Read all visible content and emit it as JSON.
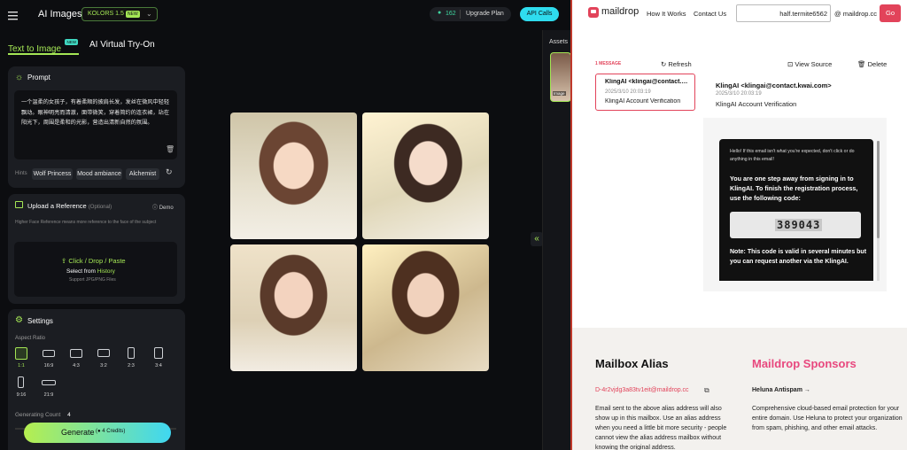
{
  "left": {
    "header": {
      "title": "AI Images",
      "model_label": "KOLORS 1.5",
      "model_badge": "NEW",
      "credits": "162",
      "upgrade_label": "Upgrade Plan",
      "api_label": "API Calls"
    },
    "tabs": [
      {
        "label": "Text to Image",
        "badge": "NEW",
        "active": true
      },
      {
        "label": "AI Virtual Try-On",
        "active": false
      }
    ],
    "prompt": {
      "title": "Prompt",
      "text": "一个温柔的女孩子，有着柔顺的披肩长发，发丝在微风中轻轻飘动。眼神明亮而清澈，面带微笑，穿着简约的连衣裙，站在阳光下，周围是柔和的光影，营造出清新自然的氛围。",
      "hints_label": "Hints",
      "hints": [
        "Wolf Princess",
        "Mood ambiance",
        "Alchemist"
      ]
    },
    "reference": {
      "title": "Upload a Reference",
      "optional": "(Optional)",
      "demo_label": "Demo",
      "description": "Higher Face Reference means more reference to the face of the subject",
      "upload_label": "Click / Drop / Paste",
      "select_from": "Select from",
      "history_link": "History",
      "support_text": "Support JPG/PNG Files"
    },
    "settings": {
      "title": "Settings",
      "aspect_label": "Aspect Ratio",
      "ratios": [
        "1:1",
        "16:9",
        "4:3",
        "3:2",
        "2:3",
        "3:4",
        "9:16",
        "21:9"
      ],
      "count_label": "Generating Count",
      "count_value": "4"
    },
    "generate": {
      "label": "Generate",
      "credits": "4 Credits"
    },
    "assets_label": "Assets",
    "assets_thumb_label": "Image",
    "colors": {
      "accent_green": "#a4e655",
      "accent_cyan": "#3fd7f2",
      "panel": "#1b1d22"
    }
  },
  "right": {
    "brand": "maildrop",
    "nav": [
      "How It Works",
      "Contact Us"
    ],
    "alias_input": "half.termite6562",
    "domain": "@ maildrop.cc",
    "go_label": "Go",
    "message_count": "1 MESSAGE",
    "refresh_label": "Refresh",
    "view_source_label": "View Source",
    "delete_label": "Delete",
    "list_item": {
      "from": "KlingAI <klingai@contact.kwai.com>",
      "date": "2025/3/10 20:03:19",
      "subject": "KlingAI Account Verification"
    },
    "email": {
      "from": "KlingAI <klingai@contact.kwai.com>",
      "date": "2025/3/10 20:03:19",
      "subject": "KlingAI Account Verification",
      "notice": "Hello! If this email isn't what you're expected, don't click or do anything in this email!",
      "body": "You are one step away from signing in to KlingAI. To finish the registration process, use the following code:",
      "code": "389043",
      "note": "Note: This code is valid in several minutes but you can request another via the KlingAI."
    },
    "mailbox_alias": {
      "title": "Mailbox Alias",
      "alias": "D-4r2vjdg3a83tv1eit@maildrop.cc",
      "text": "Email sent to the above alias address will also show up in this mailbox. Use an alias address when you need a little bit more security - people cannot view the alias address mailbox without knowing the original address."
    },
    "sponsors": {
      "title": "Maildrop Sponsors",
      "sponsor_name": "Heluna Antispam →",
      "text": "Comprehensive cloud-based email protection for your entire domain. Use Heluna to protect your organization from spam, phishing, and other email attacks."
    },
    "colors": {
      "brand_red": "#e2435a",
      "sponsor_pink": "#e8487e"
    }
  }
}
